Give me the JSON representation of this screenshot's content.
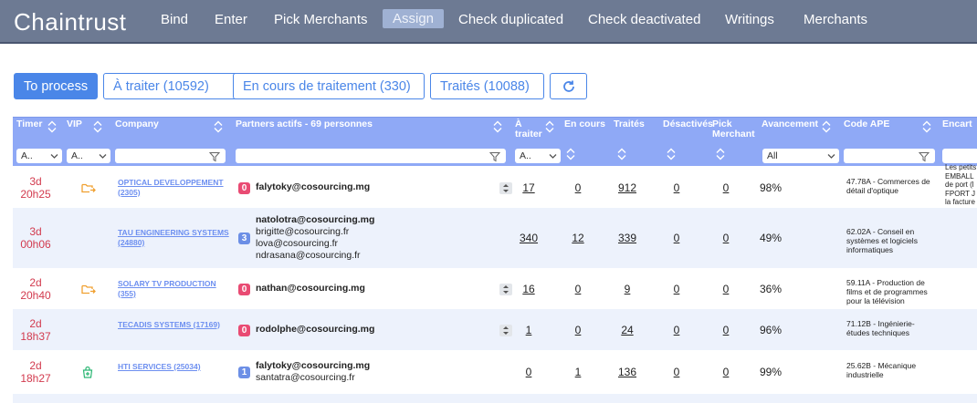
{
  "app": {
    "title": "Chaintrust"
  },
  "nav": [
    {
      "label": "Bind",
      "active": false
    },
    {
      "label": "Enter",
      "active": false
    },
    {
      "label": "Pick Merchants",
      "active": false
    },
    {
      "label": "Assign",
      "active": true
    },
    {
      "label": "Check duplicated",
      "active": false
    },
    {
      "label": "Check deactivated",
      "active": false
    },
    {
      "label": "Writings",
      "active": false
    },
    {
      "label": "Merchants",
      "active": false
    }
  ],
  "tabs": [
    "To process",
    "À traiter (10592)",
    "En cours de traitement (330)",
    "Traités (10088)"
  ],
  "refresh_icon": "refresh-icon",
  "columns": {
    "timer": "Timer",
    "vip": "VIP",
    "company": "Company",
    "partners": "Partners actifs - 69 personnes",
    "a_traiter": "À traiter",
    "en_cours": "En cours",
    "traites": "Traités",
    "desactives": "Désactivés",
    "pick_merchant": "Pick Merchant",
    "avancement": "Avancement",
    "code_ape": "Code APE",
    "encart": "Encart"
  },
  "filters": {
    "timer": "A..",
    "vip": "A..",
    "a_traiter": "A..",
    "avancement": "All"
  },
  "rows": [
    {
      "timer": [
        "3d",
        "20h25"
      ],
      "vip_icon": "folder-arrow-icon",
      "company": "OPTICAL DEVELOPPEMENT (2305)",
      "badge": "0",
      "partners": [
        "falytoky@cosourcing.mg"
      ],
      "a_traiter": "17",
      "en_cours": "0",
      "traites": "912",
      "desactives": "0",
      "pick_merchant": "0",
      "avancement": "98%",
      "code_ape": "47.78A - Commerces de détail d'optique",
      "encart": "Les petits EMBALL de port (l FPORT J la facture"
    },
    {
      "timer": [
        "3d",
        "00h06"
      ],
      "vip_icon": "",
      "company": "TAU ENGINEERING SYSTEMS (24880)",
      "badge": "3",
      "partners": [
        "natolotra@cosourcing.mg",
        "brigitte@cosourcing.fr",
        "lova@cosourcing.fr",
        "ndrasana@cosourcing.fr"
      ],
      "a_traiter": "340",
      "en_cours": "12",
      "traites": "339",
      "desactives": "0",
      "pick_merchant": "0",
      "avancement": "49%",
      "code_ape": "62.02A - Conseil en systèmes et logiciels informatiques",
      "encart": ""
    },
    {
      "timer": [
        "2d",
        "20h40"
      ],
      "vip_icon": "folder-arrow-icon",
      "company": "SOLARY TV PRODUCTION (355)",
      "badge": "0",
      "partners": [
        "nathan@cosourcing.mg"
      ],
      "a_traiter": "16",
      "en_cours": "0",
      "traites": "9",
      "desactives": "0",
      "pick_merchant": "0",
      "avancement": "36%",
      "code_ape": "59.11A - Production de films et de programmes pour la télévision",
      "encart": ""
    },
    {
      "timer": [
        "2d",
        "18h37"
      ],
      "vip_icon": "",
      "company": "TECADIS SYSTEMS (17169)",
      "badge": "0",
      "partners": [
        "rodolphe@cosourcing.mg"
      ],
      "a_traiter": "1",
      "en_cours": "0",
      "traites": "24",
      "desactives": "0",
      "pick_merchant": "0",
      "avancement": "96%",
      "code_ape": "71.12B - Ingénierie-études techniques",
      "encart": ""
    },
    {
      "timer": [
        "2d",
        "18h27"
      ],
      "vip_icon": "bag-plus-icon",
      "company": "HTI SERVICES (25034)",
      "badge": "1",
      "partners": [
        "falytoky@cosourcing.mg",
        "santatra@cosourcing.fr"
      ],
      "a_traiter": "0",
      "en_cours": "1",
      "traites": "136",
      "desactives": "0",
      "pick_merchant": "0",
      "avancement": "99%",
      "code_ape": "25.62B - Mécanique industrielle",
      "encart": ""
    }
  ],
  "colors": {
    "navbar": "#6d7a93",
    "accent": "#4a86e8",
    "header": "#8fa9f6",
    "timer": "#d23a4e",
    "badge_zero": "#e94b73",
    "badge_count": "#6c8fe6",
    "link": "#6d8ff0",
    "vip_orange": "#f0a030",
    "vip_green": "#2bb673"
  }
}
